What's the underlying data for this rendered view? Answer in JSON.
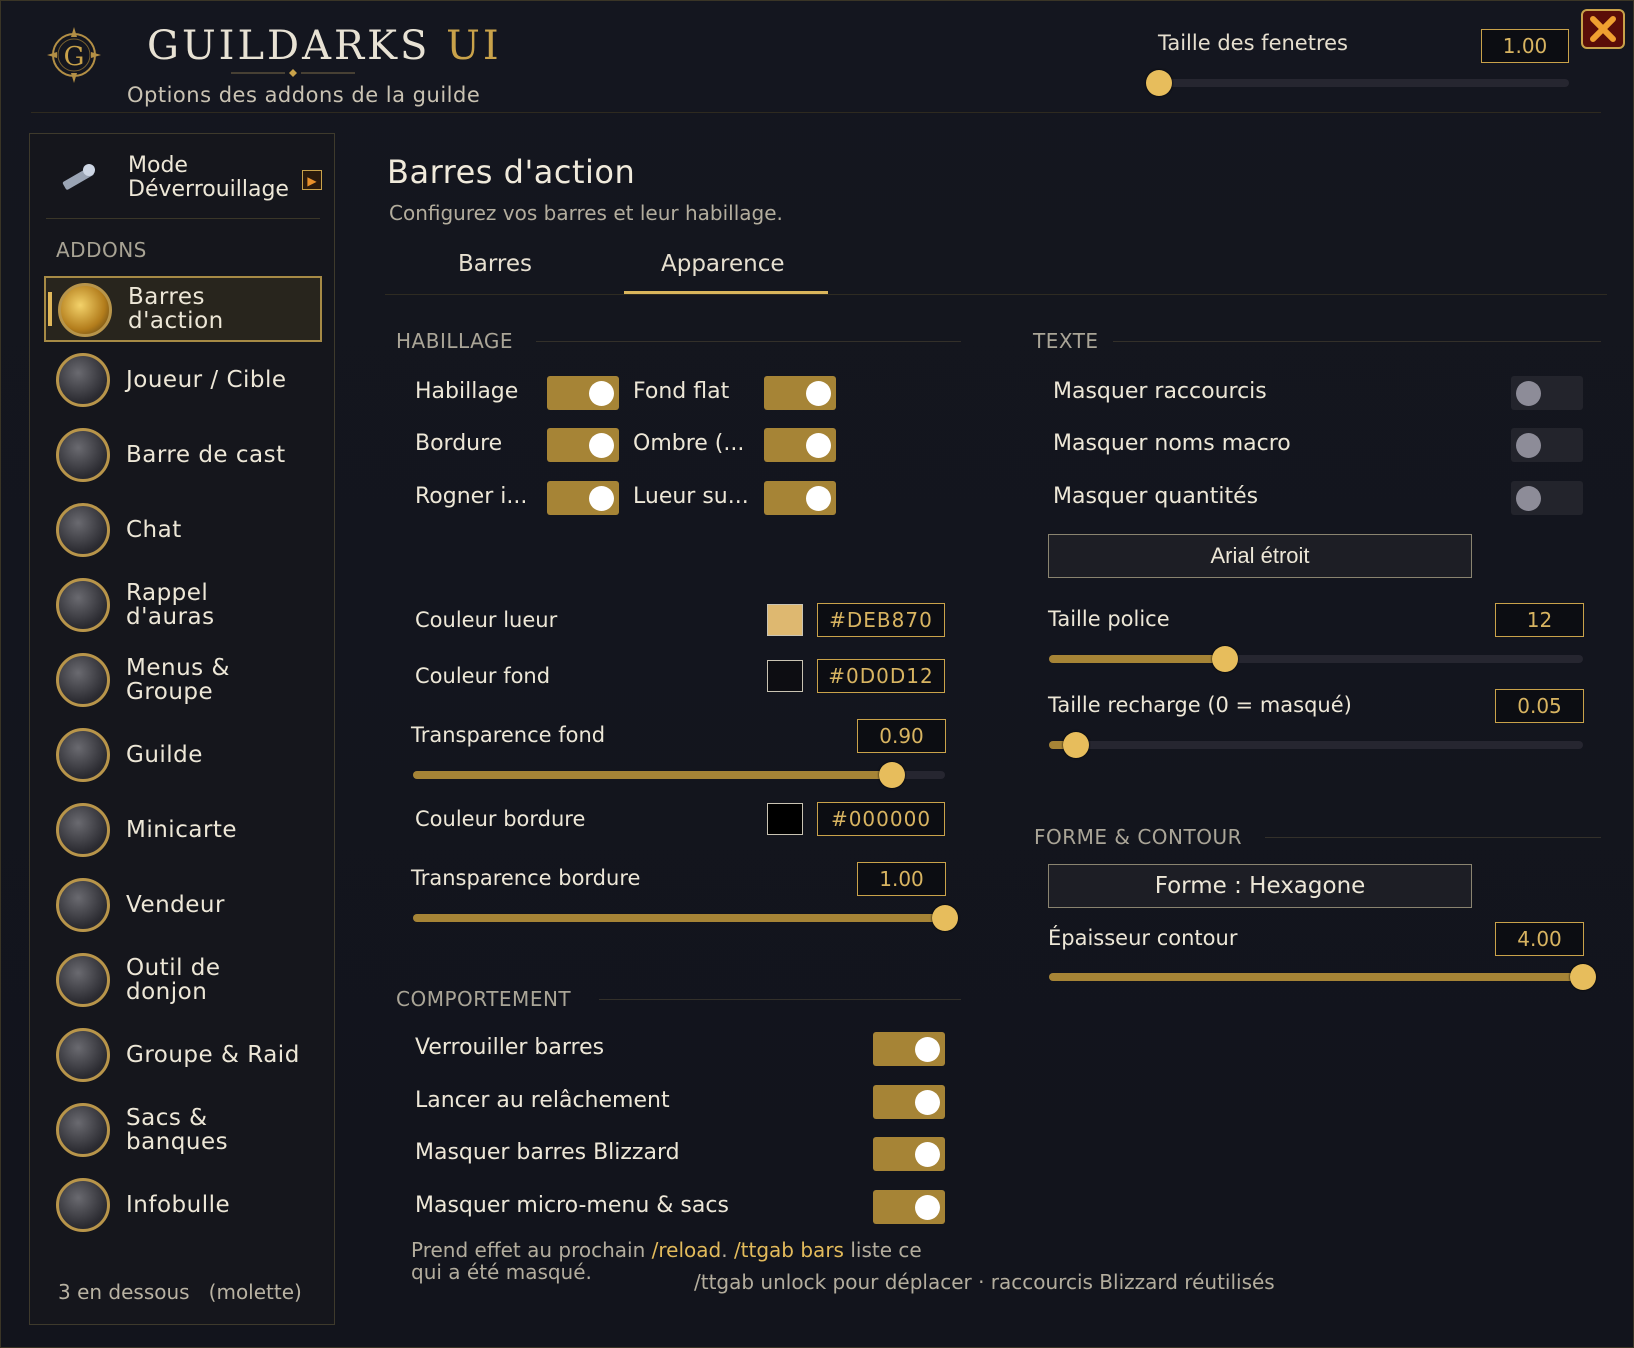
{
  "colors": {
    "accent": "#c9a24a",
    "knob": "#e7bd5c",
    "toggle_on": "#a68436",
    "close_bg": "#5a0d08",
    "close_x": "#e8902a"
  },
  "header": {
    "title_main": "GUILDARKS",
    "title_ui": "UI",
    "subtitle": "Options des addons de la guilde",
    "window_size_label": "Taille des fenetres",
    "window_size_value": "1.00",
    "window_size_fraction": 0.0,
    "close_icon": "close-x-icon"
  },
  "sidebar": {
    "unlock_label_1": "Mode",
    "unlock_label_2": "Déverrouillage",
    "section": "ADDONS",
    "items": [
      {
        "line1": "Barres",
        "line2": "d'action",
        "active": true
      },
      {
        "line1": "Joueur / Cible",
        "line2": ""
      },
      {
        "line1": "Barre de cast",
        "line2": ""
      },
      {
        "line1": "Chat",
        "line2": ""
      },
      {
        "line1": "Rappel",
        "line2": "d'auras"
      },
      {
        "line1": "Menus &",
        "line2": "Groupe"
      },
      {
        "line1": "Guilde",
        "line2": ""
      },
      {
        "line1": "Minicarte",
        "line2": ""
      },
      {
        "line1": "Vendeur",
        "line2": ""
      },
      {
        "line1": "Outil de",
        "line2": "donjon"
      },
      {
        "line1": "Groupe & Raid",
        "line2": ""
      },
      {
        "line1": "Sacs &",
        "line2": "banques"
      },
      {
        "line1": "Infobulle",
        "line2": ""
      }
    ],
    "footer": "3 en dessous   (molette)"
  },
  "main": {
    "title": "Barres d'action",
    "subtitle": "Configurez vos barres et leur habillage.",
    "tabs": [
      {
        "label": "Barres",
        "active": false
      },
      {
        "label": "Apparence",
        "active": true
      }
    ]
  },
  "habillage": {
    "head": "HABILLAGE",
    "toggles": [
      {
        "label": "Habillage",
        "on": true
      },
      {
        "label": "Fond flat",
        "on": true
      },
      {
        "label": "Bordure",
        "on": true
      },
      {
        "label": "Ombre (...",
        "on": true
      },
      {
        "label": "Rogner i...",
        "on": true
      },
      {
        "label": "Lueur su...",
        "on": true
      }
    ],
    "glow_color_label": "Couleur lueur",
    "glow_color": "#DEB870",
    "bg_color_label": "Couleur fond",
    "bg_color": "#0D0D12",
    "bg_alpha_label": "Transparence fond",
    "bg_alpha_value": "0.90",
    "bg_alpha_fraction": 0.9,
    "border_color_label": "Couleur bordure",
    "border_color": "#000000",
    "border_alpha_label": "Transparence bordure",
    "border_alpha_value": "1.00",
    "border_alpha_fraction": 1.0
  },
  "comportement": {
    "head": "COMPORTEMENT",
    "toggles": [
      {
        "label": "Verrouiller barres",
        "on": true
      },
      {
        "label": "Lancer au relâchement",
        "on": true
      },
      {
        "label": "Masquer barres Blizzard",
        "on": true
      },
      {
        "label": "Masquer micro-menu & sacs",
        "on": true
      }
    ],
    "note_prefix": "Prend effet au prochain ",
    "note_cmd1": "/reload",
    "note_mid": ". ",
    "note_cmd2": "/ttgab bars",
    "note_suffix": " liste ce",
    "note_line2": "qui a été masqué.",
    "footer_hint": "/ttgab unlock pour déplacer · raccourcis Blizzard réutilisés"
  },
  "texte": {
    "head": "TEXTE",
    "toggles": [
      {
        "label": "Masquer raccourcis",
        "on": false
      },
      {
        "label": "Masquer noms macro",
        "on": false
      },
      {
        "label": "Masquer quantités",
        "on": false
      }
    ],
    "font_button": "Arial étroit",
    "font_size_label": "Taille police",
    "font_size_value": "12",
    "font_size_fraction": 0.33,
    "cooldown_label": "Taille recharge (0 = masqué)",
    "cooldown_value": "0.05",
    "cooldown_fraction": 0.05
  },
  "forme": {
    "head": "FORME & CONTOUR",
    "shape_button": "Forme : Hexagone",
    "thickness_label": "Épaisseur contour",
    "thickness_value": "4.00",
    "thickness_fraction": 1.0
  }
}
